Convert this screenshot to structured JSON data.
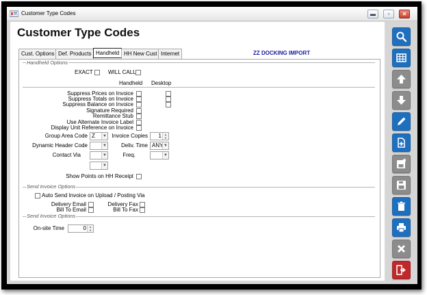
{
  "window": {
    "title": "Customer Type Codes"
  },
  "page": {
    "title": "Customer Type Codes"
  },
  "tabs": [
    {
      "label": "Cust. Options"
    },
    {
      "label": "Def. Products"
    },
    {
      "label": "Handheld",
      "active": true
    },
    {
      "label": "HH New Cust"
    },
    {
      "label": "Internet"
    }
  ],
  "customer_label": "ZZ  DOCKING IMPORT",
  "handheld_options": {
    "group_label": "Handheld Options",
    "exact_label": "EXACT",
    "will_call_label": "WILL CALL",
    "col_handheld": "Handheld",
    "col_desktop": "Desktop",
    "rows": [
      {
        "label": "Suppress Prices on Invoice",
        "handheld": false,
        "desktop": false
      },
      {
        "label": "Suppress Totals on Invoice",
        "handheld": false,
        "desktop": false
      },
      {
        "label": "Suppress Balance on Invoice",
        "handheld": false,
        "desktop": false
      },
      {
        "label": "Signature Required",
        "handheld": false
      },
      {
        "label": "Remittance Stub",
        "handheld": false
      },
      {
        "label": "Use Alternate Invoice Label",
        "handheld": false
      },
      {
        "label": "Display Unit Reference on Invoice",
        "handheld": false
      }
    ],
    "group_area_code_label": "Group Area Code",
    "group_area_code_value": "Z",
    "invoice_copies_label": "Invoice Copies",
    "invoice_copies_value": "1",
    "dynamic_header_code_label": "Dynamic Header Code",
    "dynamic_header_code_value": "",
    "deliv_time_label": "Deliv. Time",
    "deliv_time_value": "ANY",
    "contact_via_label": "Contact Via",
    "contact_via_value": "",
    "freq_label": "Freq.",
    "freq_value": "",
    "extra_value": "",
    "show_points_label": "Show Points on HH Receipt"
  },
  "send_invoice_options": {
    "group_label": "Send Invoice Options",
    "auto_send_label": "Auto Send Invoice on Upload / Posting Via",
    "delivery_email_label": "Delivery Email",
    "delivery_fax_label": "Delivery Fax",
    "bill_to_email_label": "Bill To Email",
    "bill_to_fax_label": "Bill To Fax"
  },
  "send_invoice_options_2": {
    "group_label": "Send Invoice Options",
    "on_site_time_label": "On-site Time",
    "on_site_time_value": "0"
  },
  "toolbar": [
    {
      "icon": "search-icon",
      "color": "#1f6fbf"
    },
    {
      "icon": "grid-icon",
      "color": "#1f6fbf"
    },
    {
      "icon": "arrow-up-icon",
      "color": "#8c8c8c"
    },
    {
      "icon": "arrow-down-icon",
      "color": "#8c8c8c"
    },
    {
      "icon": "edit-pencil-icon",
      "color": "#1f6fbf"
    },
    {
      "icon": "add-document-icon",
      "color": "#1f6fbf"
    },
    {
      "icon": "save-new-icon",
      "color": "#8c8c8c"
    },
    {
      "icon": "save-icon",
      "color": "#8c8c8c"
    },
    {
      "icon": "delete-trash-icon",
      "color": "#1f6fbf"
    },
    {
      "icon": "print-icon",
      "color": "#1f6fbf"
    },
    {
      "icon": "close-x-icon",
      "color": "#8c8c8c"
    },
    {
      "icon": "exit-door-icon",
      "color": "#c0282a"
    }
  ],
  "colors": {
    "accent_blue": "#1f6fbf",
    "exit_red": "#c0282a",
    "customer_text": "#1a1aa0"
  }
}
